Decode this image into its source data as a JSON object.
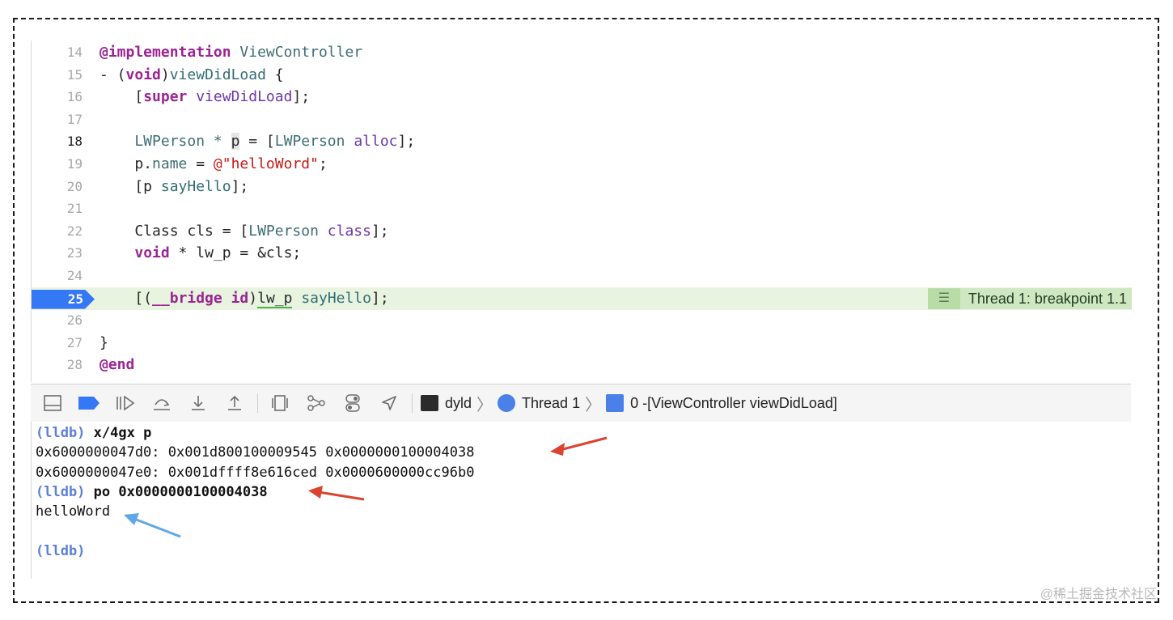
{
  "editor": {
    "lines": [
      {
        "num": "14",
        "segments": [
          {
            "t": "@implementation",
            "c": "kw"
          },
          {
            "t": " ",
            "c": ""
          },
          {
            "t": "ViewController",
            "c": "cls"
          }
        ]
      },
      {
        "num": "15",
        "segments": [
          {
            "t": "- (",
            "c": ""
          },
          {
            "t": "void",
            "c": "kw"
          },
          {
            "t": ")",
            "c": ""
          },
          {
            "t": "viewDidLoad",
            "c": "meth"
          },
          {
            "t": " {",
            "c": ""
          }
        ]
      },
      {
        "num": "16",
        "segments": [
          {
            "t": "    [",
            "c": ""
          },
          {
            "t": "super",
            "c": "kw"
          },
          {
            "t": " ",
            "c": ""
          },
          {
            "t": "viewDidLoad",
            "c": "pur"
          },
          {
            "t": "];",
            "c": ""
          }
        ]
      },
      {
        "num": "17",
        "segments": []
      },
      {
        "num": "18",
        "segments": [
          {
            "t": "    LWPerson * ",
            "c": "cls"
          },
          {
            "t": "p",
            "c": "cursorbox"
          },
          {
            "t": " = [",
            "c": ""
          },
          {
            "t": "LWPerson",
            "c": "cls"
          },
          {
            "t": " ",
            "c": ""
          },
          {
            "t": "alloc",
            "c": "pur"
          },
          {
            "t": "];",
            "c": ""
          }
        ]
      },
      {
        "num": "19",
        "segments": [
          {
            "t": "    p.",
            "c": ""
          },
          {
            "t": "name",
            "c": "cls"
          },
          {
            "t": " = ",
            "c": ""
          },
          {
            "t": "@\"helloWord\"",
            "c": "str"
          },
          {
            "t": ";",
            "c": ""
          }
        ]
      },
      {
        "num": "20",
        "segments": [
          {
            "t": "    [p ",
            "c": ""
          },
          {
            "t": "sayHello",
            "c": "meth"
          },
          {
            "t": "];",
            "c": ""
          }
        ]
      },
      {
        "num": "21",
        "segments": []
      },
      {
        "num": "22",
        "segments": [
          {
            "t": "    Class cls = [",
            "c": ""
          },
          {
            "t": "LWPerson",
            "c": "cls"
          },
          {
            "t": " ",
            "c": ""
          },
          {
            "t": "class",
            "c": "pur"
          },
          {
            "t": "];",
            "c": ""
          }
        ]
      },
      {
        "num": "23",
        "segments": [
          {
            "t": "    ",
            "c": ""
          },
          {
            "t": "void",
            "c": "kw"
          },
          {
            "t": " * lw_p = &cls;",
            "c": ""
          }
        ]
      },
      {
        "num": "24",
        "segments": []
      },
      {
        "num": "25",
        "segments": [
          {
            "t": "    [(",
            "c": ""
          },
          {
            "t": "__bridge",
            "c": "kw"
          },
          {
            "t": " ",
            "c": ""
          },
          {
            "t": "id",
            "c": "kw"
          },
          {
            "t": ")",
            "c": ""
          },
          {
            "t": "lw_p",
            "c": "uline"
          },
          {
            "t": " ",
            "c": ""
          },
          {
            "t": "sayHello",
            "c": "meth"
          },
          {
            "t": "];",
            "c": ""
          }
        ]
      },
      {
        "num": "26",
        "segments": []
      },
      {
        "num": "27",
        "segments": [
          {
            "t": "}",
            "c": ""
          }
        ]
      },
      {
        "num": "28",
        "segments": [
          {
            "t": "@end",
            "c": "kw"
          }
        ]
      }
    ],
    "breakpoint_line": "25",
    "current_line": "18",
    "thread_badge": "Thread 1: breakpoint 1.1"
  },
  "toolbar": {
    "icons": [
      "hide-debug-area-icon",
      "breakpoint-icon",
      "continue-icon",
      "step-over-icon",
      "step-into-icon",
      "step-out-icon",
      "view-hierarchy-icon",
      "memory-graph-icon",
      "environment-overrides-icon",
      "simulate-location-icon"
    ],
    "breadcrumb": {
      "process": "dyld",
      "thread": "Thread 1",
      "frame": "0 -[ViewController viewDidLoad]"
    }
  },
  "console": {
    "lines": [
      {
        "prompt": "(lldb)",
        "cmd": " x/4gx p",
        "text": ""
      },
      {
        "prompt": "",
        "cmd": "",
        "text": "0x6000000047d0: 0x001d800100009545 0x0000000100004038"
      },
      {
        "prompt": "",
        "cmd": "",
        "text": "0x6000000047e0: 0x001dffff8e616ced 0x0000600000cc96b0"
      },
      {
        "prompt": "(lldb)",
        "cmd": " po 0x0000000100004038",
        "text": ""
      },
      {
        "prompt": "",
        "cmd": "",
        "text": "helloWord"
      },
      {
        "prompt": "",
        "cmd": "",
        "text": ""
      },
      {
        "prompt": "(lldb)",
        "cmd": "",
        "text": ""
      }
    ]
  },
  "watermark": "@稀土掘金技术社区",
  "colors": {
    "breakpoint": "#3478f6",
    "highlight": "#e8f4e0",
    "arrow_red": "#d9432f",
    "arrow_blue": "#5fa8e6"
  }
}
